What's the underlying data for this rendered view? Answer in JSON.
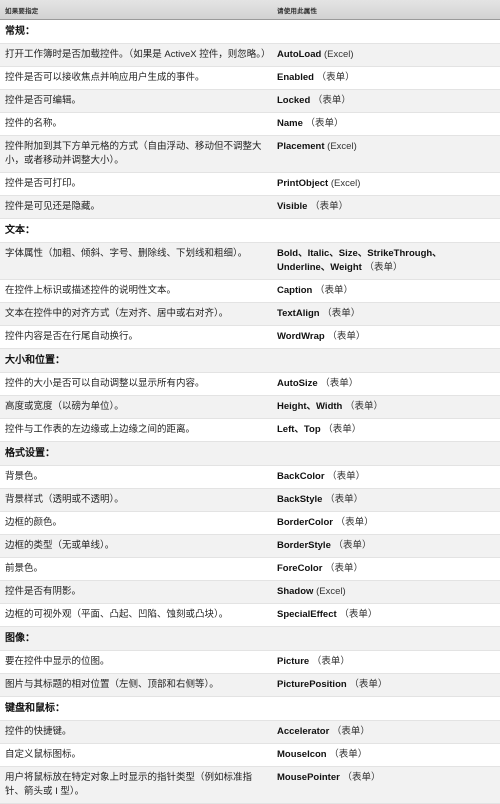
{
  "table": {
    "header": {
      "col_description": "如果要指定",
      "col_property": "请使用此属性"
    },
    "sections": [
      {
        "title": "常规：",
        "rows": [
          {
            "description": "打开工作簿时是否加载控件。（如果是 ActiveX 控件，则忽略。）",
            "property_name": "AutoLoad",
            "property_suffix": "(Excel)"
          },
          {
            "description": "控件是否可以接收焦点并响应用户生成的事件。",
            "property_name": "Enabled",
            "property_suffix": "（表单）"
          },
          {
            "description": "控件是否可编辑。",
            "property_name": "Locked",
            "property_suffix": "（表单）"
          },
          {
            "description": "控件的名称。",
            "property_name": "Name",
            "property_suffix": "（表单）"
          },
          {
            "description": "控件附加到其下方单元格的方式（自由浮动、移动但不调整大小，或者移动并调整大小）。",
            "property_name": "Placement",
            "property_suffix": "(Excel)"
          },
          {
            "description": "控件是否可打印。",
            "property_name": "PrintObject",
            "property_suffix": "(Excel)"
          },
          {
            "description": "控件是可见还是隐藏。",
            "property_name": "Visible",
            "property_suffix": "（表单）"
          }
        ]
      },
      {
        "title": "文本：",
        "rows": [
          {
            "description": "字体属性（加粗、倾斜、字号、删除线、下划线和粗细）。",
            "property_name": "Bold、Italic、Size、StrikeThrough、Underline、Weight",
            "property_suffix": "（表单）"
          },
          {
            "description": "在控件上标识或描述控件的说明性文本。",
            "property_name": "Caption",
            "property_suffix": "（表单）"
          },
          {
            "description": "文本在控件中的对齐方式（左对齐、居中或右对齐）。",
            "property_name": "TextAlign",
            "property_suffix": "（表单）"
          },
          {
            "description": "控件内容是否在行尾自动换行。",
            "property_name": "WordWrap",
            "property_suffix": "（表单）"
          }
        ]
      },
      {
        "title": "大小和位置：",
        "rows": [
          {
            "description": "控件的大小是否可以自动调整以显示所有内容。",
            "property_name": "AutoSize",
            "property_suffix": "（表单）"
          },
          {
            "description": "高度或宽度（以磅为单位）。",
            "property_name": "Height、Width",
            "property_suffix": "（表单）"
          },
          {
            "description": "控件与工作表的左边缘或上边缘之间的距离。",
            "property_name": "Left、Top",
            "property_suffix": "（表单）"
          }
        ]
      },
      {
        "title": "格式设置：",
        "rows": [
          {
            "description": "背景色。",
            "property_name": "BackColor",
            "property_suffix": "（表单）"
          },
          {
            "description": "背景样式（透明或不透明）。",
            "property_name": "BackStyle",
            "property_suffix": "（表单）"
          },
          {
            "description": "边框的颜色。",
            "property_name": "BorderColor",
            "property_suffix": "（表单）"
          },
          {
            "description": "边框的类型（无或单线）。",
            "property_name": "BorderStyle",
            "property_suffix": "（表单）"
          },
          {
            "description": "前景色。",
            "property_name": "ForeColor",
            "property_suffix": "（表单）"
          },
          {
            "description": "控件是否有阴影。",
            "property_name": "Shadow",
            "property_suffix": "(Excel)"
          },
          {
            "description": "边框的可视外观（平面、凸起、凹陷、蚀刻或凸块）。",
            "property_name": "SpecialEffect",
            "property_suffix": "（表单）"
          }
        ]
      },
      {
        "title": "图像：",
        "rows": [
          {
            "description": "要在控件中显示的位图。",
            "property_name": "Picture",
            "property_suffix": "（表单）"
          },
          {
            "description": "图片与其标题的相对位置（左侧、顶部和右侧等）。",
            "property_name": "PicturePosition",
            "property_suffix": "（表单）"
          }
        ]
      },
      {
        "title": "键盘和鼠标：",
        "rows": [
          {
            "description": "控件的快捷键。",
            "property_name": "Accelerator",
            "property_suffix": "（表单）"
          },
          {
            "description": "自定义鼠标图标。",
            "property_name": "MouseIcon",
            "property_suffix": "（表单）"
          },
          {
            "description": "用户将鼠标放在特定对象上时显示的指针类型（例如标准指针、箭头或 I 型）。",
            "property_name": "MousePointer",
            "property_suffix": "（表单）"
          }
        ]
      }
    ]
  }
}
